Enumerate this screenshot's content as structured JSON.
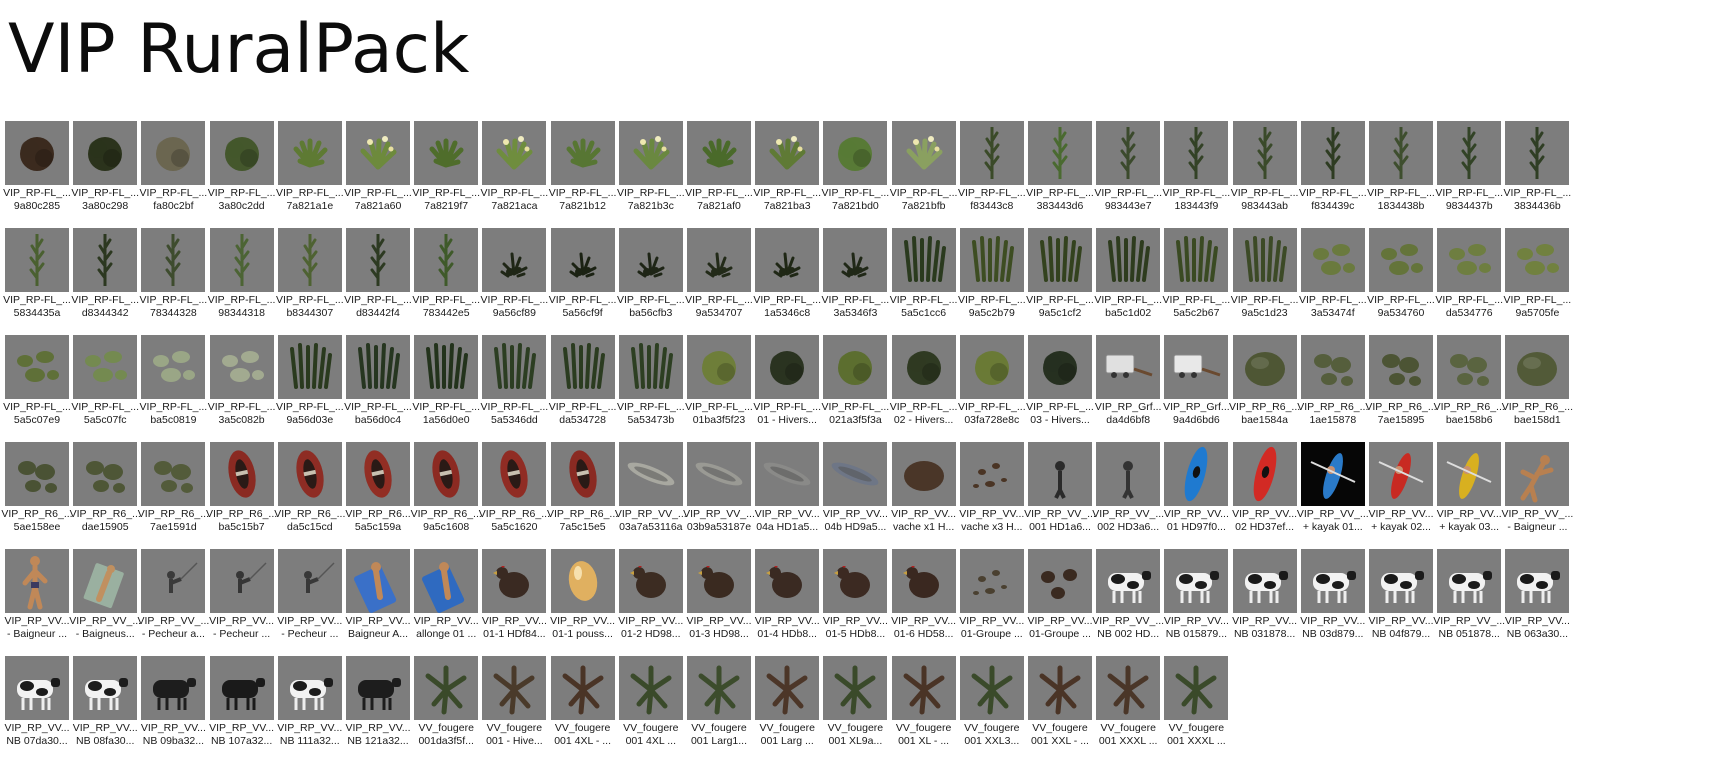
{
  "page": {
    "title": "VIP RuralPack"
  },
  "rows": [
    [
      {
        "l1": "VIP_RP-FL_...",
        "l2": "9a80c285",
        "icon": "shrub-icon",
        "c": "#3b2a1e"
      },
      {
        "l1": "VIP_RP-FL_...",
        "l2": "3a80c298",
        "icon": "shrub-icon",
        "c": "#2b331c"
      },
      {
        "l1": "VIP_RP-FL_...",
        "l2": "fa80c2bf",
        "icon": "shrub-icon",
        "c": "#6b6650"
      },
      {
        "l1": "VIP_RP-FL_...",
        "l2": "3a80c2dd",
        "icon": "shrub-icon",
        "c": "#44572c"
      },
      {
        "l1": "VIP_RP-FL_...",
        "l2": "7a821a1e",
        "icon": "plant-icon",
        "c": "#5e7a33"
      },
      {
        "l1": "VIP_RP-FL_...",
        "l2": "7a821a60",
        "icon": "flower-plant-icon",
        "c": "#6d8a3c"
      },
      {
        "l1": "VIP_RP-FL_...",
        "l2": "7a8219f7",
        "icon": "plant-icon",
        "c": "#4f6d2b"
      },
      {
        "l1": "VIP_RP-FL_...",
        "l2": "7a821aca",
        "icon": "flower-plant-icon",
        "c": "#6f8d3e"
      },
      {
        "l1": "VIP_RP-FL_...",
        "l2": "7a821b12",
        "icon": "plant-icon",
        "c": "#577633"
      },
      {
        "l1": "VIP_RP-FL_...",
        "l2": "7a821b3c",
        "icon": "flower-plant-icon",
        "c": "#6a8840"
      },
      {
        "l1": "VIP_RP-FL_...",
        "l2": "7a821af0",
        "icon": "plant-icon",
        "c": "#4a6a2a"
      },
      {
        "l1": "VIP_RP-FL_...",
        "l2": "7a821ba3",
        "icon": "flower-plant-icon",
        "c": "#5f7a35"
      },
      {
        "l1": "VIP_RP-FL_...",
        "l2": "7a821bd0",
        "icon": "shrub-icon",
        "c": "#587a36"
      },
      {
        "l1": "VIP_RP-FL_...",
        "l2": "7a821bfb",
        "icon": "flower-plant-icon",
        "c": "#8aa060"
      },
      {
        "l1": "VIP_RP-FL_...",
        "l2": "f83443c8",
        "icon": "tall-reed-icon",
        "c": "#3a4a28"
      },
      {
        "l1": "VIP_RP-FL_...",
        "l2": "383443d6",
        "icon": "tall-reed-icon",
        "c": "#4a6a30"
      },
      {
        "l1": "VIP_RP-FL_...",
        "l2": "983443e7",
        "icon": "tall-reed-icon",
        "c": "#3b4a2c"
      },
      {
        "l1": "VIP_RP-FL_...",
        "l2": "183443f9",
        "icon": "tall-reed-icon",
        "c": "#334226"
      },
      {
        "l1": "VIP_RP-FL_...",
        "l2": "983443ab",
        "icon": "tall-reed-icon",
        "c": "#3a4a2a"
      },
      {
        "l1": "VIP_RP-FL_...",
        "l2": "f834439c",
        "icon": "tall-reed-icon",
        "c": "#2e3c22"
      },
      {
        "l1": "VIP_RP-FL_...",
        "l2": "1834438b",
        "icon": "tall-reed-icon",
        "c": "#3e4e2e"
      },
      {
        "l1": "VIP_RP-FL_...",
        "l2": "9834437b",
        "icon": "tall-reed-icon",
        "c": "#324326"
      },
      {
        "l1": "VIP_RP-FL_...",
        "l2": "3834436b",
        "icon": "tall-reed-icon",
        "c": "#2f3e24"
      }
    ],
    [
      {
        "l1": "VIP_RP-FL_...",
        "l2": "5834435a",
        "icon": "tall-reed-icon",
        "c": "#4a6030"
      },
      {
        "l1": "VIP_RP-FL_...",
        "l2": "d8344342",
        "icon": "tall-reed-icon",
        "c": "#2c3820"
      },
      {
        "l1": "VIP_RP-FL_...",
        "l2": "78344328",
        "icon": "tall-reed-icon",
        "c": "#3e4c2e"
      },
      {
        "l1": "VIP_RP-FL_...",
        "l2": "98344318",
        "icon": "tall-reed-icon",
        "c": "#4c6434"
      },
      {
        "l1": "VIP_RP-FL_...",
        "l2": "b8344307",
        "icon": "tall-reed-icon",
        "c": "#4e6232"
      },
      {
        "l1": "VIP_RP-FL_...",
        "l2": "d83442f4",
        "icon": "tall-reed-icon",
        "c": "#2d3a22"
      },
      {
        "l1": "VIP_RP-FL_...",
        "l2": "783442e5",
        "icon": "tall-reed-icon",
        "c": "#3f5a2a"
      },
      {
        "l1": "VIP_RP-FL_...",
        "l2": "9a56cf89",
        "icon": "sparse-weed-icon",
        "c": "#1f2616"
      },
      {
        "l1": "VIP_RP-FL_...",
        "l2": "5a56cf9f",
        "icon": "sparse-weed-icon",
        "c": "#1b2213"
      },
      {
        "l1": "VIP_RP-FL_...",
        "l2": "ba56cfb3",
        "icon": "sparse-weed-icon",
        "c": "#1e2516"
      },
      {
        "l1": "VIP_RP-FL_...",
        "l2": "9a534707",
        "icon": "sparse-weed-icon",
        "c": "#222a18"
      },
      {
        "l1": "VIP_RP-FL_...",
        "l2": "1a5346c8",
        "icon": "sparse-weed-icon",
        "c": "#1f2715"
      },
      {
        "l1": "VIP_RP-FL_...",
        "l2": "3a5346f3",
        "icon": "sparse-weed-icon",
        "c": "#202817"
      },
      {
        "l1": "VIP_RP-FL_...",
        "l2": "5a5c1cc6",
        "icon": "grass-tuft-icon",
        "c": "#2a3a1e"
      },
      {
        "l1": "VIP_RP-FL_...",
        "l2": "9a5c2b79",
        "icon": "grass-tuft-icon",
        "c": "#3d4d22"
      },
      {
        "l1": "VIP_RP-FL_...",
        "l2": "9a5c1cf2",
        "icon": "grass-tuft-icon",
        "c": "#33421e"
      },
      {
        "l1": "VIP_RP-FL_...",
        "l2": "ba5c1d02",
        "icon": "grass-tuft-icon",
        "c": "#2e3c1e"
      },
      {
        "l1": "VIP_RP-FL_...",
        "l2": "5a5c2b67",
        "icon": "grass-tuft-icon",
        "c": "#3a4a22"
      },
      {
        "l1": "VIP_RP-FL_...",
        "l2": "9a5c1d23",
        "icon": "grass-tuft-icon",
        "c": "#3c4a26"
      },
      {
        "l1": "VIP_RP-FL_...",
        "l2": "3a53474f",
        "icon": "lily-pad-icon",
        "c": "#6a7a3e"
      },
      {
        "l1": "VIP_RP-FL_...",
        "l2": "9a534760",
        "icon": "lily-pad-icon",
        "c": "#64743a"
      },
      {
        "l1": "VIP_RP-FL_...",
        "l2": "da534776",
        "icon": "lily-pad-icon",
        "c": "#6e7e40"
      },
      {
        "l1": "VIP_RP-FL_...",
        "l2": "9a5705fe",
        "icon": "lily-pad-icon",
        "c": "#71813f"
      }
    ],
    [
      {
        "l1": "VIP_RP-FL_...",
        "l2": "5a5c07e9",
        "icon": "lily-pad-icon",
        "c": "#5f7038"
      },
      {
        "l1": "VIP_RP-FL_...",
        "l2": "5a5c07fc",
        "icon": "lily-pad-icon",
        "c": "#748a50"
      },
      {
        "l1": "VIP_RP-FL_...",
        "l2": "ba5c0819",
        "icon": "lily-pad-icon",
        "c": "#9aa686"
      },
      {
        "l1": "VIP_RP-FL_...",
        "l2": "3a5c082b",
        "icon": "lily-pad-icon",
        "c": "#a2aa90"
      },
      {
        "l1": "VIP_RP-FL_...",
        "l2": "9a56d03e",
        "icon": "grass-tuft-icon",
        "c": "#2a3a1e"
      },
      {
        "l1": "VIP_RP-FL_...",
        "l2": "ba56d0c4",
        "icon": "grass-tuft-icon",
        "c": "#263620"
      },
      {
        "l1": "VIP_RP-FL_...",
        "l2": "1a56d0e0",
        "icon": "grass-tuft-icon",
        "c": "#23331c"
      },
      {
        "l1": "VIP_RP-FL_...",
        "l2": "5a5346dd",
        "icon": "grass-tuft-icon",
        "c": "#2c3e22"
      },
      {
        "l1": "VIP_RP-FL_...",
        "l2": "da534728",
        "icon": "grass-tuft-icon",
        "c": "#2b3c20"
      },
      {
        "l1": "VIP_RP-FL_...",
        "l2": "5a53473b",
        "icon": "grass-tuft-icon",
        "c": "#2d3f22"
      },
      {
        "l1": "VIP_RP-FL_...",
        "l2": "01ba3f5f23",
        "icon": "shrub-icon",
        "c": "#6e7e3a"
      },
      {
        "l1": "VIP_RP-FL_...",
        "l2": "01 - Hivers...",
        "icon": "shrub-icon",
        "c": "#2a3320"
      },
      {
        "l1": "VIP_RP-FL_...",
        "l2": "021a3f5f3a",
        "icon": "shrub-icon",
        "c": "#5c6e30"
      },
      {
        "l1": "VIP_RP-FL_...",
        "l2": "02 - Hivers...",
        "icon": "shrub-icon",
        "c": "#2f3a22"
      },
      {
        "l1": "VIP_RP-FL_...",
        "l2": "03fa728e8c",
        "icon": "shrub-icon",
        "c": "#6a7a36"
      },
      {
        "l1": "VIP_RP-FL_...",
        "l2": "03 - Hivers...",
        "icon": "shrub-icon",
        "c": "#263020"
      },
      {
        "l1": "VIP_RP_Grf...",
        "l2": "da4d6bf8",
        "icon": "trailer-icon",
        "c": "#e0e0e0"
      },
      {
        "l1": "VIP_RP_Grf...",
        "l2": "9a4d6bd6",
        "icon": "trailer-icon",
        "c": "#e8e8e8"
      },
      {
        "l1": "VIP_RP_R6_...",
        "l2": "bae1584a",
        "icon": "rock-icon",
        "c": "#4e5634"
      },
      {
        "l1": "VIP_RP_R6_...",
        "l2": "1ae15878",
        "icon": "rocks-icon",
        "c": "#555e3c"
      },
      {
        "l1": "VIP_RP_R6_...",
        "l2": "7ae15895",
        "icon": "rocks-icon",
        "c": "#4c5434"
      },
      {
        "l1": "VIP_RP_R6_...",
        "l2": "bae158b6",
        "icon": "rocks-icon",
        "c": "#5a6440"
      },
      {
        "l1": "VIP_RP_R6_...",
        "l2": "bae158d1",
        "icon": "rock-icon",
        "c": "#525a38"
      }
    ],
    [
      {
        "l1": "VIP_RP_R6_...",
        "l2": "5ae158ee",
        "icon": "rocks-icon",
        "c": "#4a5234"
      },
      {
        "l1": "VIP_RP_R6_...",
        "l2": "dae15905",
        "icon": "rocks-icon",
        "c": "#4e5636"
      },
      {
        "l1": "VIP_RP_R6_...",
        "l2": "7ae1591d",
        "icon": "rocks-icon",
        "c": "#535b3a"
      },
      {
        "l1": "VIP_RP_R6_...",
        "l2": "ba5c15b7",
        "icon": "dinghy-icon",
        "c": "#8a2a22"
      },
      {
        "l1": "VIP_RP_R6_...",
        "l2": "da5c15cd",
        "icon": "dinghy-icon",
        "c": "#8e2c24"
      },
      {
        "l1": "VIP_RP_R6...",
        "l2": "5a5c159a",
        "icon": "dinghy-icon",
        "c": "#922e24"
      },
      {
        "l1": "VIP_RP_R6_...",
        "l2": "9a5c1608",
        "icon": "dinghy-icon",
        "c": "#8c2a22"
      },
      {
        "l1": "VIP_RP_R6_...",
        "l2": "5a5c1620",
        "icon": "dinghy-icon",
        "c": "#902c24"
      },
      {
        "l1": "VIP_RP_R6_...",
        "l2": "7a5c15e5",
        "icon": "dinghy-icon",
        "c": "#8a2a22"
      },
      {
        "l1": "VIP_RP_VV_...",
        "l2": "03a7a53116a",
        "icon": "rowboat-icon",
        "c": "#a8a8a0"
      },
      {
        "l1": "VIP_RP_VV_...",
        "l2": "03b9a53187e",
        "icon": "rowboat-icon",
        "c": "#9a9a94"
      },
      {
        "l1": "VIP_RP_VV...",
        "l2": "04a HD1a5...",
        "icon": "rowboat-icon",
        "c": "#8a8a88"
      },
      {
        "l1": "VIP_RP_VV...",
        "l2": "04b HD9a5...",
        "icon": "rowboat-icon",
        "c": "#6e7686"
      },
      {
        "l1": "VIP_RP_VV...",
        "l2": "vache x1 H...",
        "icon": "mound-icon",
        "c": "#4a3628"
      },
      {
        "l1": "VIP_RP_VV...",
        "l2": "vache x3 H...",
        "icon": "droppings-icon",
        "c": "#4a3424"
      },
      {
        "l1": "VIP_RP_VV_...",
        "l2": "001 HD1a6...",
        "icon": "figure-icon",
        "c": "#2a2a2a"
      },
      {
        "l1": "VIP_RP_VV_...",
        "l2": "002 HD3a6...",
        "icon": "figure-icon",
        "c": "#333333"
      },
      {
        "l1": "VIP_RP_VV...",
        "l2": "01 HD97f0...",
        "icon": "kayak-icon",
        "c": "#1f7ad0"
      },
      {
        "l1": "VIP_RP_VV...",
        "l2": "02 HD37ef...",
        "icon": "kayak-icon",
        "c": "#d22a24"
      },
      {
        "l1": "VIP_RP_VV_...",
        "l2": "+ kayak 01...",
        "icon": "kayaker-icon",
        "c": "#2a7ac8",
        "dark": true
      },
      {
        "l1": "VIP_RP_VV...",
        "l2": "+ kayak 02...",
        "icon": "kayaker-icon",
        "c": "#c82a22"
      },
      {
        "l1": "VIP_RP_VV...",
        "l2": "+ kayak 03...",
        "icon": "kayaker-icon",
        "c": "#d8b020"
      },
      {
        "l1": "VIP_RP_VV_...",
        "l2": "- Baigneur ...",
        "icon": "swimmer-icon",
        "c": "#b88050"
      }
    ],
    [
      {
        "l1": "VIP_RP_VV...",
        "l2": "- Baigneur ...",
        "icon": "bather-icon",
        "c": "#c08858"
      },
      {
        "l1": "VIP_RP_VV_...",
        "l2": "- Baigneus...",
        "icon": "sunbather-icon",
        "c": "#c09060"
      },
      {
        "l1": "VIP_RP_VV_...",
        "l2": "- Pecheur a...",
        "icon": "fisherman-icon",
        "c": "#3a3a3a"
      },
      {
        "l1": "VIP_RP_VV...",
        "l2": "- Pecheur ...",
        "icon": "fisherman-icon",
        "c": "#353535"
      },
      {
        "l1": "VIP_RP_VV...",
        "l2": "- Pecheur ...",
        "icon": "fisherman-icon",
        "c": "#383838"
      },
      {
        "l1": "VIP_RP_VV...",
        "l2": "Baigneur A...",
        "icon": "bather-on-mat-icon",
        "c": "#3a70c8"
      },
      {
        "l1": "VIP_RP_VV...",
        "l2": "allonge 01 ...",
        "icon": "bather-on-mat-icon",
        "c": "#2f6ac0"
      },
      {
        "l1": "VIP_RP_VV...",
        "l2": "01-1 HDf84...",
        "icon": "chicken-icon",
        "c": "#3a2a22"
      },
      {
        "l1": "VIP_RP_VV...",
        "l2": "01-1 pouss...",
        "icon": "egg-icon",
        "c": "#e0b060"
      },
      {
        "l1": "VIP_RP_VV...",
        "l2": "01-2 HD98...",
        "icon": "chicken-icon",
        "c": "#3c2c22"
      },
      {
        "l1": "VIP_RP_VV...",
        "l2": "01-3 HD98...",
        "icon": "chicken-icon",
        "c": "#3a2a20"
      },
      {
        "l1": "VIP_RP_VV...",
        "l2": "01-4 HDb8...",
        "icon": "chicken-icon",
        "c": "#3a2a22"
      },
      {
        "l1": "VIP_RP_VV...",
        "l2": "01-5 HDb8...",
        "icon": "chicken-icon",
        "c": "#3c2a22"
      },
      {
        "l1": "VIP_RP_VV...",
        "l2": "01-6 HD58...",
        "icon": "chicken-icon",
        "c": "#3a2820"
      },
      {
        "l1": "VIP_RP_VV...",
        "l2": "01-Groupe ...",
        "icon": "droppings-icon",
        "c": "#4a4030"
      },
      {
        "l1": "VIP_RP_VV...",
        "l2": "01-Groupe ...",
        "icon": "chicken-group-icon",
        "c": "#3a2a20"
      },
      {
        "l1": "VIP_RP_VV_...",
        "l2": "NB 002 HD...",
        "icon": "cow-icon",
        "c": "#1a1a1a"
      },
      {
        "l1": "VIP_RP_VV...",
        "l2": "NB 015879...",
        "icon": "cow-icon",
        "c": "#1c1c1c"
      },
      {
        "l1": "VIP_RP_VV...",
        "l2": "NB 031878...",
        "icon": "cow-icon",
        "c": "#1a1a1a"
      },
      {
        "l1": "VIP_RP_VV...",
        "l2": "NB 03d879...",
        "icon": "cow-icon",
        "c": "#1b1b1b"
      },
      {
        "l1": "VIP_RP_VV...",
        "l2": "NB 04f879...",
        "icon": "cow-icon",
        "c": "#1a1a1a"
      },
      {
        "l1": "VIP_RP_VV_...",
        "l2": "NB 051878...",
        "icon": "cow-icon",
        "c": "#1c1c1c"
      },
      {
        "l1": "VIP_RP_VV...",
        "l2": "NB 063a30...",
        "icon": "cow-icon",
        "c": "#1a1a1a"
      }
    ],
    [
      {
        "l1": "VIP_RP_VV...",
        "l2": "NB 07da30...",
        "icon": "cow-icon",
        "c": "#1a1a1a"
      },
      {
        "l1": "VIP_RP_VV...",
        "l2": "NB 08fa30...",
        "icon": "cow-icon",
        "c": "#1c1c1c"
      },
      {
        "l1": "VIP_RP_VV...",
        "l2": "NB 09ba32...",
        "icon": "cow-icon",
        "c": "#1d1d1d",
        "solid": true
      },
      {
        "l1": "VIP_RP_VV...",
        "l2": "NB 107a32...",
        "icon": "cow-icon",
        "c": "#1a1a1a",
        "solid": true
      },
      {
        "l1": "VIP_RP_VV...",
        "l2": "NB 111a32...",
        "icon": "cow-icon",
        "c": "#1c1c1c"
      },
      {
        "l1": "VIP_RP_VV...",
        "l2": "NB 121a32...",
        "icon": "cow-icon",
        "c": "#1d1d1d",
        "solid": true
      },
      {
        "l1": "VV_fougere",
        "l2": "001da3f5f...",
        "icon": "fern-icon",
        "c": "#3a4a2a"
      },
      {
        "l1": "VV_fougere",
        "l2": "001 - Hive...",
        "icon": "fern-icon",
        "c": "#4a3a2a"
      },
      {
        "l1": "VV_fougere",
        "l2": "001 4XL - ...",
        "icon": "fern-icon",
        "c": "#4a3426"
      },
      {
        "l1": "VV_fougere",
        "l2": "001 4XL ...",
        "icon": "fern-icon",
        "c": "#3a4a2a"
      },
      {
        "l1": "VV_fougere",
        "l2": "001 Larg1...",
        "icon": "fern-icon",
        "c": "#3c4c2c"
      },
      {
        "l1": "VV_fougere",
        "l2": "001 Larg ...",
        "icon": "fern-icon",
        "c": "#4c3628"
      },
      {
        "l1": "VV_fougere",
        "l2": "001 XL9a...",
        "icon": "fern-icon",
        "c": "#3a4a2a"
      },
      {
        "l1": "VV_fougere",
        "l2": "001 XL - ...",
        "icon": "fern-icon",
        "c": "#4a3426"
      },
      {
        "l1": "VV_fougere",
        "l2": "001 XXL3...",
        "icon": "fern-icon",
        "c": "#3a4a2a"
      },
      {
        "l1": "VV_fougere",
        "l2": "001 XXL - ...",
        "icon": "fern-icon",
        "c": "#4a3426"
      },
      {
        "l1": "VV_fougere",
        "l2": "001 XXXL ...",
        "icon": "fern-icon",
        "c": "#4a3628"
      },
      {
        "l1": "VV_fougere",
        "l2": "001 XXXL ...",
        "icon": "fern-icon",
        "c": "#3a4a2a"
      }
    ]
  ]
}
